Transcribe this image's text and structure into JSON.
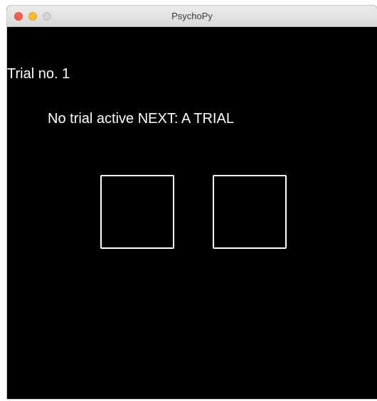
{
  "window": {
    "title": "PsychoPy"
  },
  "stimuli": {
    "trial_label": "Trial no. 1",
    "status_text": "No trial active NEXT: A TRIAL"
  },
  "colors": {
    "background": "#000000",
    "foreground": "#ffffff"
  }
}
